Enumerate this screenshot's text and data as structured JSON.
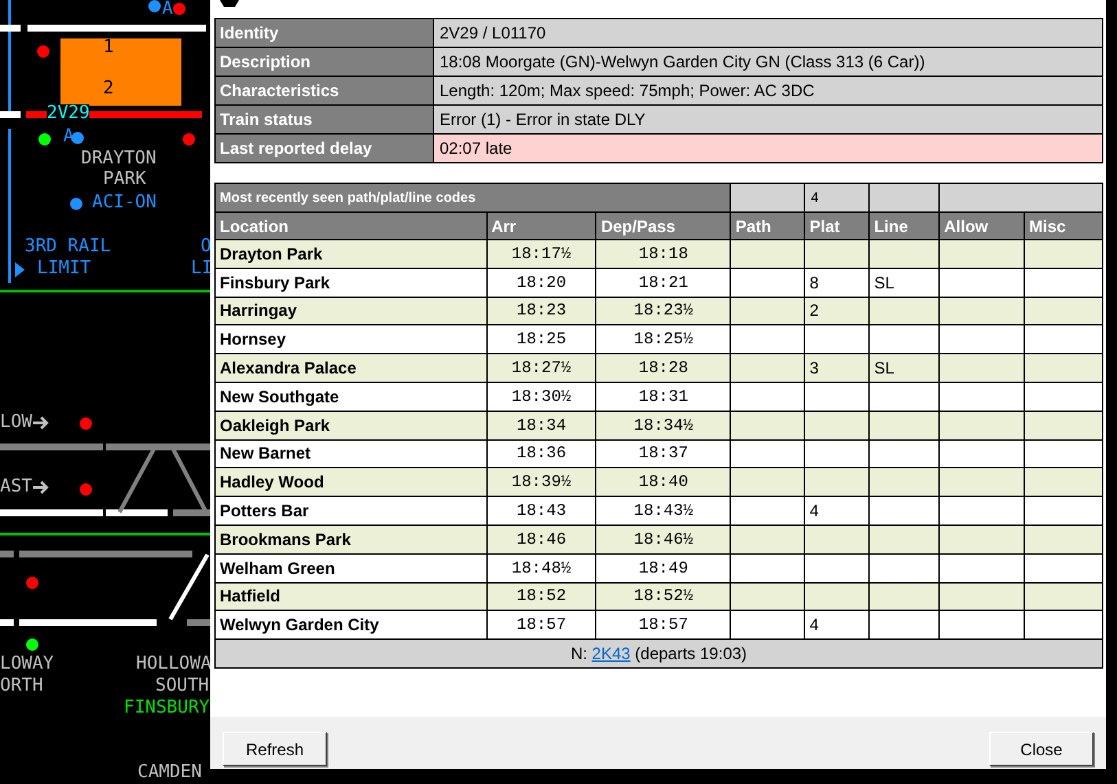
{
  "diagram": {
    "labels": [
      {
        "text": "A",
        "color": "#1e90ff"
      },
      {
        "text": "1",
        "color": "#000000"
      },
      {
        "text": "2",
        "color": "#000000"
      },
      {
        "text": "2V29",
        "color": "#00ffff"
      },
      {
        "text": "A",
        "color": "#1e90ff"
      },
      {
        "text": "DRAYTON",
        "color": "#c0c0c0"
      },
      {
        "text": "PARK",
        "color": "#c0c0c0"
      },
      {
        "text": "ACI-ON",
        "color": "#1e90ff"
      },
      {
        "text": "3RD RAIL",
        "color": "#1e90ff"
      },
      {
        "text": "LIMIT",
        "color": "#1e90ff"
      },
      {
        "text": "O",
        "color": "#1e90ff"
      },
      {
        "text": "LI",
        "color": "#1e90ff"
      },
      {
        "text": "LOW",
        "color": "#c0c0c0"
      },
      {
        "text": "AST",
        "color": "#c0c0c0"
      },
      {
        "text": "LOWAY",
        "color": "#c0c0c0"
      },
      {
        "text": "ORTH",
        "color": "#c0c0c0"
      },
      {
        "text": "HOLLOWA",
        "color": "#c0c0c0"
      },
      {
        "text": "SOUTH",
        "color": "#c0c0c0"
      },
      {
        "text": "FINSBURY",
        "color": "#00e000"
      },
      {
        "text": "CAMDEN",
        "color": "#c0c0c0"
      }
    ],
    "signals": [
      {
        "color": "#ff0000"
      },
      {
        "color": "#ff0000"
      },
      {
        "color": "#00ff00"
      },
      {
        "color": "#1e90ff"
      },
      {
        "color": "#ff0000"
      },
      {
        "color": "#1e90ff"
      },
      {
        "color": "#1e90ff"
      },
      {
        "color": "#ff0000"
      },
      {
        "color": "#ff0000"
      },
      {
        "color": "#ff0000"
      },
      {
        "color": "#00ff00"
      }
    ]
  },
  "details": [
    {
      "label": "Identity",
      "value": "2V29 / L01170",
      "alert": false
    },
    {
      "label": "Description",
      "value": "18:08 Moorgate (GN)-Welwyn Garden City GN (Class 313 (6 Car))",
      "alert": false
    },
    {
      "label": "Characteristics",
      "value": "Length: 120m; Max speed: 75mph; Power: AC 3DC",
      "alert": false
    },
    {
      "label": "Train status",
      "value": "Error (1) - Error in state DLY",
      "alert": false
    },
    {
      "label": "Last reported delay",
      "value": "02:07 late",
      "alert": true
    }
  ],
  "timetable": {
    "codes_heading": "Most recently seen path/plat/line codes",
    "recent_plat": "4",
    "columns": [
      "Location",
      "Arr",
      "Dep/Pass",
      "Path",
      "Plat",
      "Line",
      "Allow",
      "Misc"
    ],
    "rows": [
      {
        "location": "Drayton Park",
        "arr": "18:17½",
        "dep": "18:18"
      },
      {
        "location": "Finsbury Park",
        "arr": "18:20",
        "dep": "18:21",
        "plat": "8",
        "line": "SL"
      },
      {
        "location": "Harringay",
        "arr": "18:23",
        "dep": "18:23½",
        "plat": "2"
      },
      {
        "location": "Hornsey",
        "arr": "18:25",
        "dep": "18:25½"
      },
      {
        "location": "Alexandra Palace",
        "arr": "18:27½",
        "dep": "18:28",
        "plat": "3",
        "line": "SL"
      },
      {
        "location": "New Southgate",
        "arr": "18:30½",
        "dep": "18:31"
      },
      {
        "location": "Oakleigh Park",
        "arr": "18:34",
        "dep": "18:34½"
      },
      {
        "location": "New Barnet",
        "arr": "18:36",
        "dep": "18:37"
      },
      {
        "location": "Hadley Wood",
        "arr": "18:39½",
        "dep": "18:40"
      },
      {
        "location": "Potters Bar",
        "arr": "18:43",
        "dep": "18:43½",
        "plat": "4"
      },
      {
        "location": "Brookmans Park",
        "arr": "18:46",
        "dep": "18:46½"
      },
      {
        "location": "Welham Green",
        "arr": "18:48½",
        "dep": "18:49"
      },
      {
        "location": "Hatfield",
        "arr": "18:52",
        "dep": "18:52½"
      },
      {
        "location": "Welwyn Garden City",
        "arr": "18:57",
        "dep": "18:57",
        "plat": "4"
      }
    ],
    "next": {
      "prefix": "N:",
      "link": "2K43",
      "suffix": "(departs 19:03)"
    }
  },
  "buttons": [
    "Refresh",
    "Close"
  ]
}
